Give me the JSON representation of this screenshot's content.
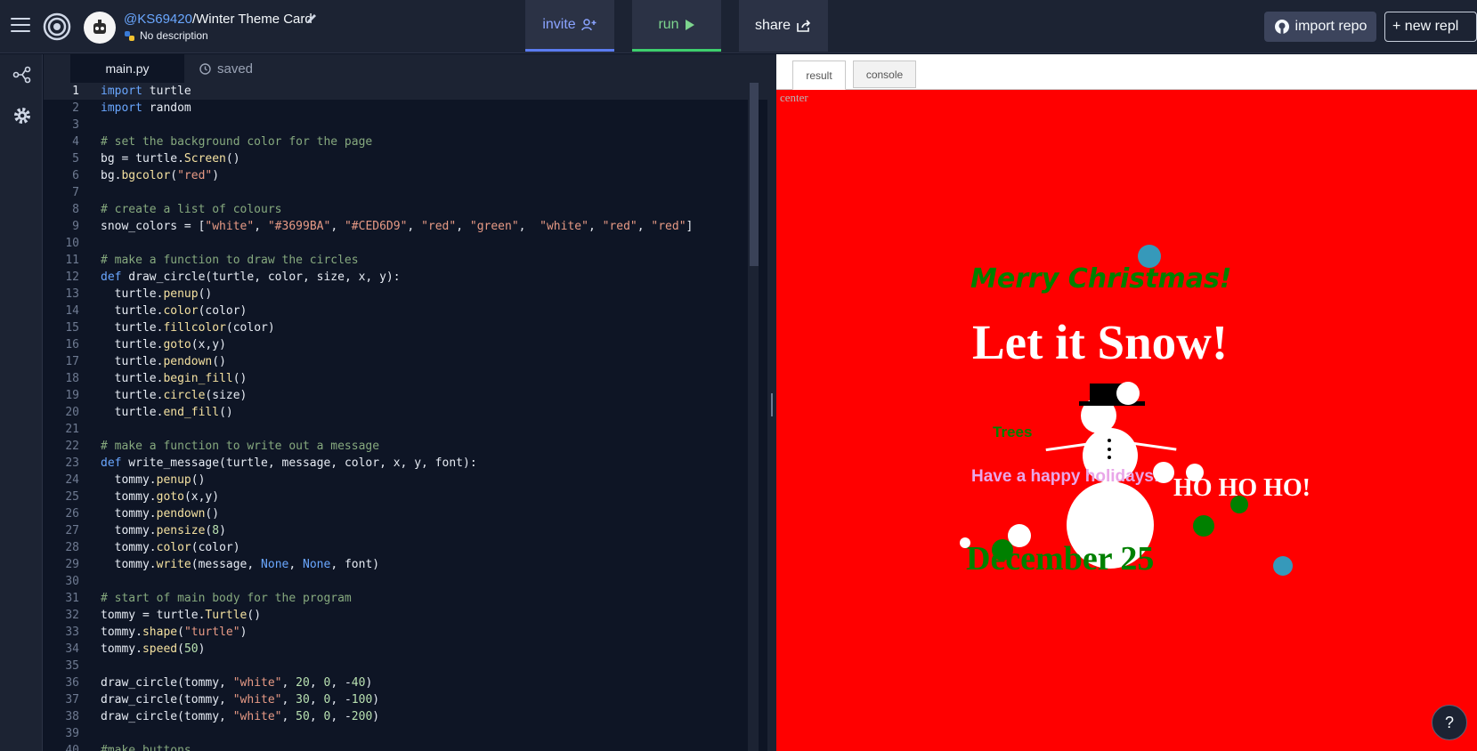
{
  "header": {
    "username": "@KS69420",
    "repl_name": "/Winter Theme Card",
    "description": "No description",
    "invite_label": "invite",
    "run_label": "run",
    "share_label": "share",
    "import_label": "import repo",
    "new_label": "+ new repl"
  },
  "editor": {
    "tab_name": "main.py",
    "saved_label": "saved",
    "active_line": 1,
    "lines": [
      "import turtle",
      "import random",
      "",
      "# set the background color for the page",
      "bg = turtle.Screen()",
      "bg.bgcolor(\"red\")",
      "",
      "# create a list of colours",
      "snow_colors = [\"white\", \"#3699BA\", \"#CED6D9\", \"red\", \"green\",  \"white\", \"red\", \"red\"]",
      "",
      "# make a function to draw the circles",
      "def draw_circle(turtle, color, size, x, y):",
      "  turtle.penup()",
      "  turtle.color(color)",
      "  turtle.fillcolor(color)",
      "  turtle.goto(x,y)",
      "  turtle.pendown()",
      "  turtle.begin_fill()",
      "  turtle.circle(size)",
      "  turtle.end_fill()",
      "",
      "# make a function to write out a message",
      "def write_message(turtle, message, color, x, y, font):",
      "  tommy.penup()",
      "  tommy.goto(x,y)",
      "  tommy.pendown()",
      "  tommy.pensize(8)",
      "  tommy.color(color)",
      "  tommy.write(message, None, None, font)",
      "",
      "# start of main body for the program",
      "tommy = turtle.Turtle()",
      "tommy.shape(\"turtle\")",
      "tommy.speed(50)",
      "",
      "draw_circle(tommy, \"white\", 20, 0, -40)",
      "draw_circle(tommy, \"white\", 30, 0, -100)",
      "draw_circle(tommy, \"white\", 50, 0, -200)",
      "",
      "#make buttons"
    ]
  },
  "output": {
    "tab_result": "result",
    "tab_console": "console",
    "center_label": "center",
    "canvas_bg": "#ff0000",
    "texts": {
      "merry": "Merry Christmas!",
      "snow": "Let it Snow!",
      "trees": "Trees",
      "happy": "Have a happy holidays!",
      "ho": "HO HO HO!",
      "date": "December 25"
    }
  },
  "help_label": "?",
  "colors": {
    "accent_run": "#3ecf6e",
    "accent_invite": "#5b7cf0",
    "snow_blue": "#3699ba",
    "green": "#008000"
  }
}
